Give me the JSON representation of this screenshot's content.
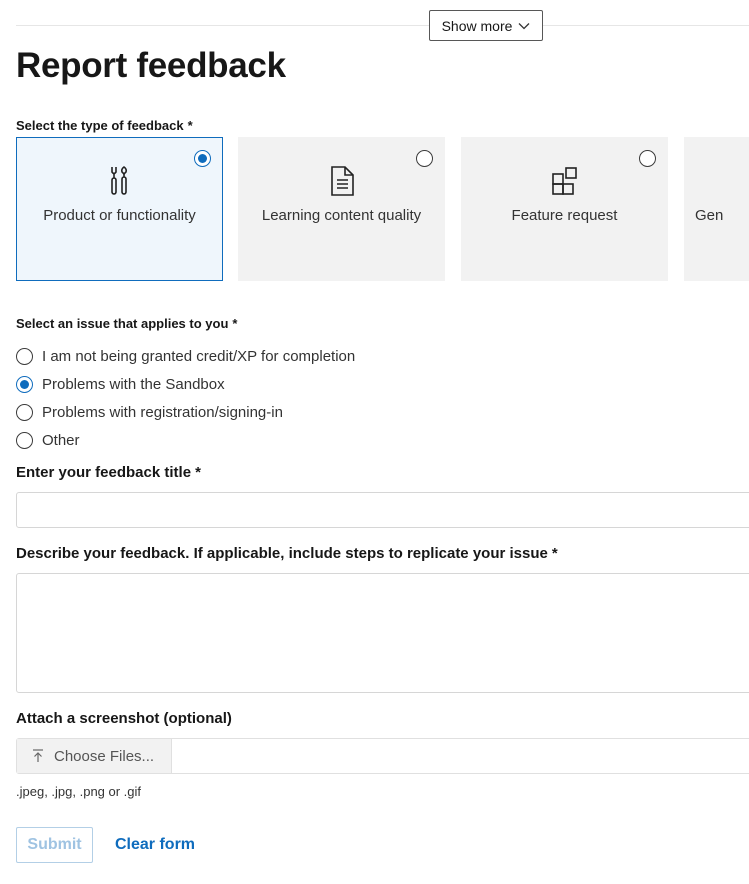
{
  "header": {
    "show_more_label": "Show more",
    "title": "Report feedback"
  },
  "feedback_type": {
    "label": "Select the type of feedback",
    "required_mark": "*",
    "options": [
      {
        "label": "Product or functionality",
        "icon": "tools-icon",
        "selected": true
      },
      {
        "label": "Learning content quality",
        "icon": "document-icon",
        "selected": false
      },
      {
        "label": "Feature request",
        "icon": "apps-add-icon",
        "selected": false
      },
      {
        "label": "Gen",
        "icon": "chat-icon",
        "selected": false
      }
    ]
  },
  "issue": {
    "label": "Select an issue that applies to you",
    "required_mark": "*",
    "options": [
      {
        "label": "I am not being granted credit/XP for completion",
        "selected": false
      },
      {
        "label": "Problems with the Sandbox",
        "selected": true
      },
      {
        "label": "Problems with registration/signing-in",
        "selected": false
      },
      {
        "label": "Other",
        "selected": false
      }
    ]
  },
  "title_field": {
    "label": "Enter your feedback title",
    "required_mark": "*",
    "value": "",
    "placeholder": ""
  },
  "description_field": {
    "label": "Describe your feedback. If applicable, include steps to replicate your issue",
    "required_mark": "*",
    "value": ""
  },
  "attachment": {
    "label": "Attach a screenshot (optional)",
    "button_label": "Choose Files...",
    "hint": ".jpeg, .jpg, .png or .gif"
  },
  "actions": {
    "submit_label": "Submit",
    "clear_label": "Clear form"
  },
  "colors": {
    "accent": "#0f6cbd",
    "card_bg": "#f2f2f2",
    "selected_card_bg": "#eff6fc",
    "disabled_text": "#9fc3e2"
  }
}
